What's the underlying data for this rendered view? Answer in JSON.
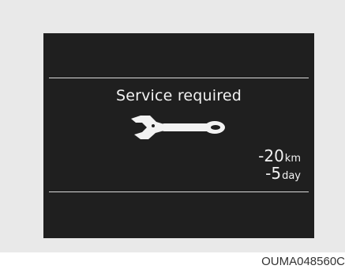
{
  "display": {
    "title": "Service required",
    "icon": "wrench-icon",
    "distance": {
      "value": "-20",
      "unit": "km"
    },
    "days": {
      "value": "-5",
      "unit": "day"
    }
  },
  "caption": "OUMA048560C",
  "colors": {
    "screen_bg": "#1f1f1f",
    "text": "#f2f2f2",
    "frame_bg": "#e9e9e9"
  }
}
